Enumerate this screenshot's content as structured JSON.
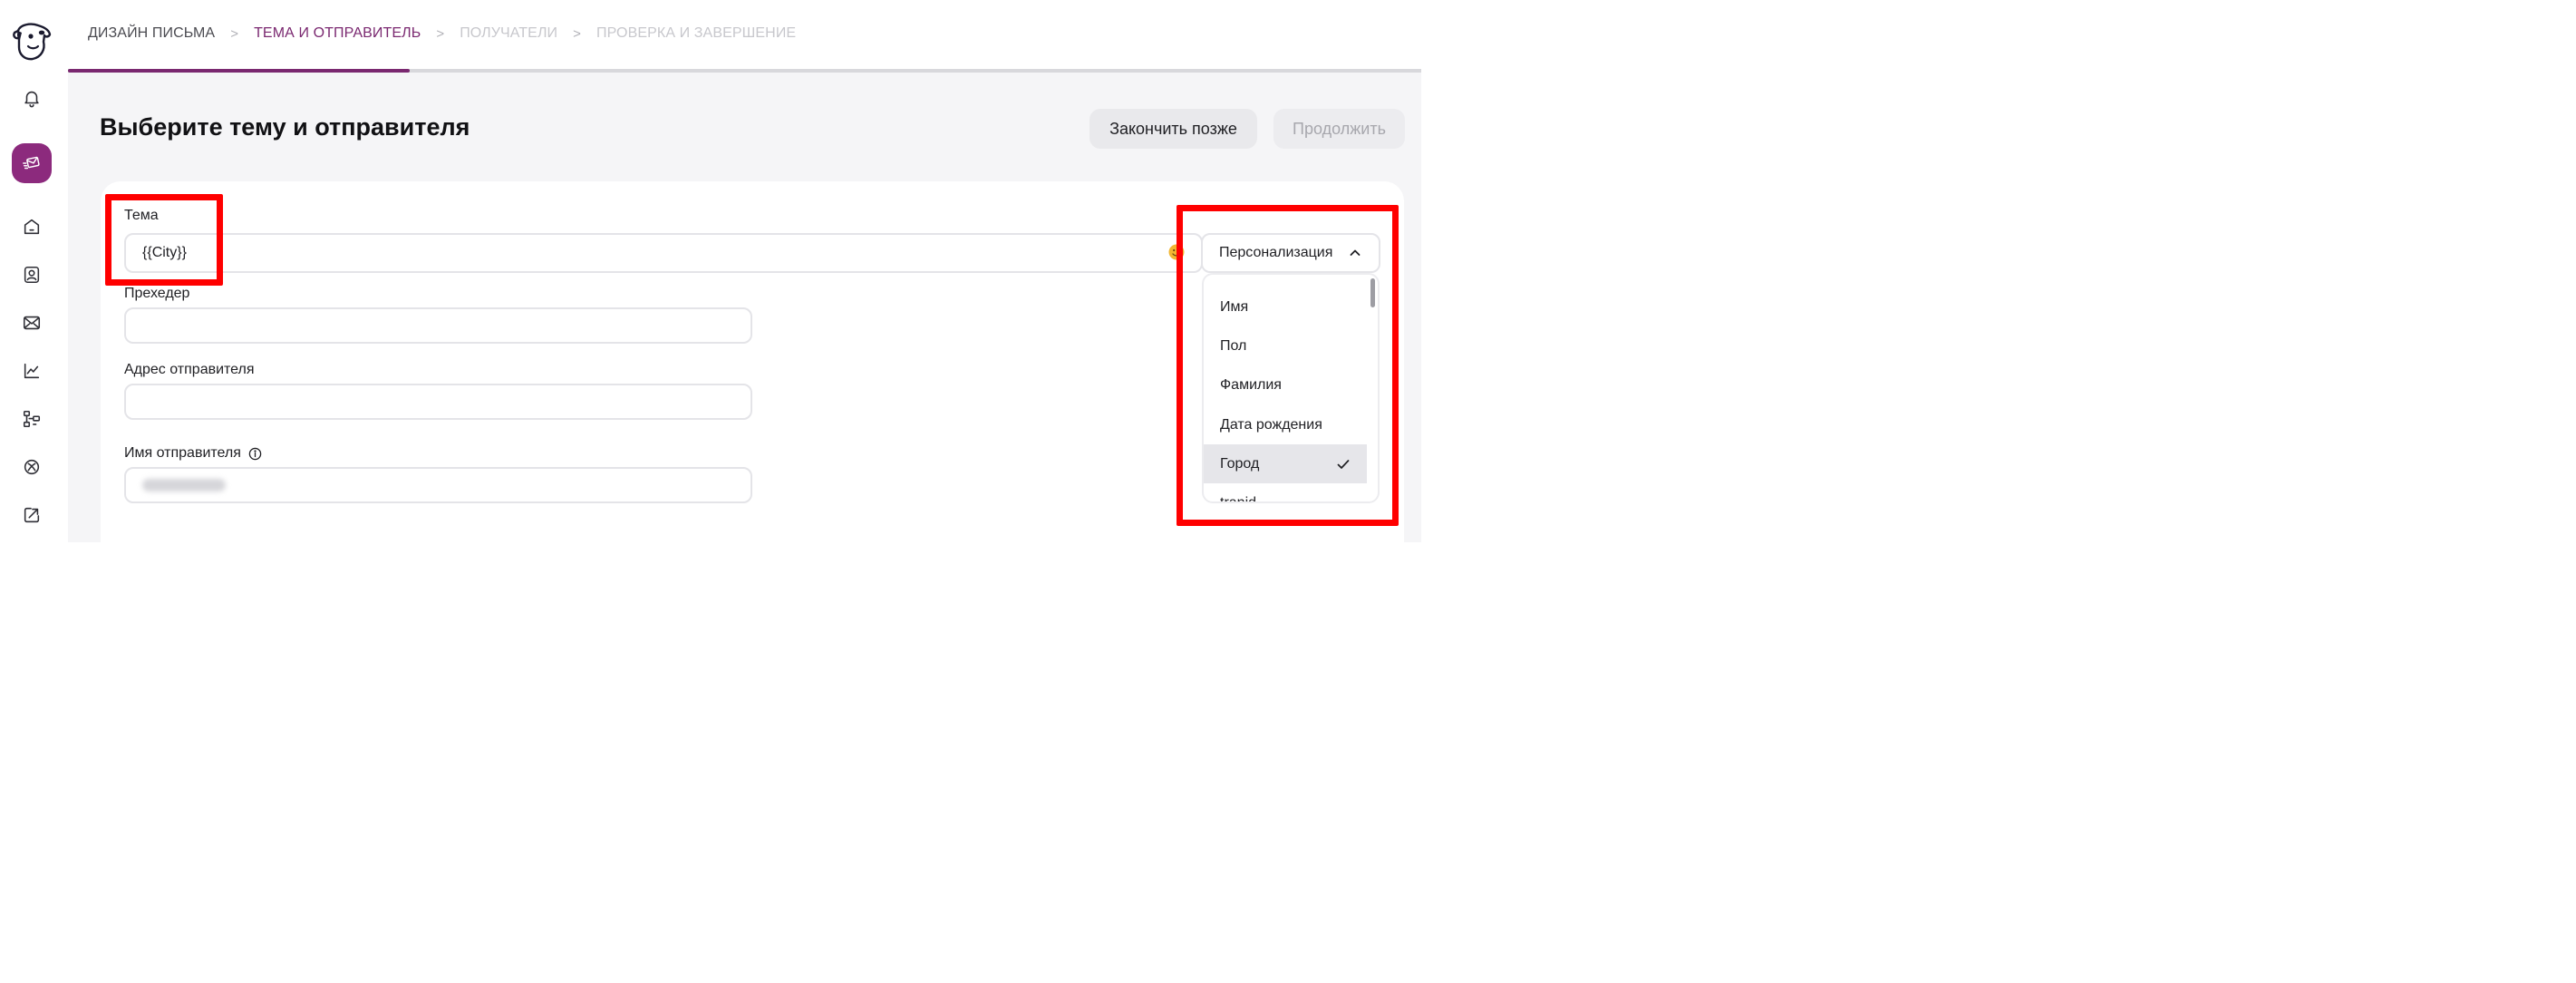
{
  "breadcrumb": {
    "steps": [
      {
        "label": "ДИЗАЙН ПИСЬМА",
        "state": "done"
      },
      {
        "label": "ТЕМА И ОТПРАВИТЕЛЬ",
        "state": "current"
      },
      {
        "label": "ПОЛУЧАТЕЛИ",
        "state": "upcoming"
      },
      {
        "label": "ПРОВЕРКА И ЗАВЕРШЕНИЕ",
        "state": "upcoming"
      }
    ],
    "separator": ">"
  },
  "progress": {
    "fraction": 0.25
  },
  "sidebar": {
    "items": [
      {
        "icon": "bell-icon",
        "active": false
      },
      {
        "icon": "mail-send-icon",
        "active": true
      },
      {
        "icon": "home-icon",
        "active": false
      },
      {
        "icon": "contacts-icon",
        "active": false
      },
      {
        "icon": "envelope-icon",
        "active": false
      },
      {
        "icon": "chart-icon",
        "active": false
      },
      {
        "icon": "automation-icon",
        "active": false
      },
      {
        "icon": "integrations-icon",
        "active": false
      },
      {
        "icon": "export-icon",
        "active": false
      }
    ]
  },
  "page": {
    "title": "Выберите тему и отправителя",
    "finish_later_label": "Закончить позже",
    "continue_label": "Продолжить"
  },
  "form": {
    "subject_label": "Тема",
    "subject_value": "{{City}}",
    "preheader_label": "Прехедер",
    "preheader_value": "",
    "sender_address_label": "Адрес отправителя",
    "sender_address_value": "",
    "sender_name_label": "Имя отправителя",
    "sender_name_value_hidden": true
  },
  "personalization": {
    "button_label": "Персонализация",
    "options": [
      {
        "label": "Имя",
        "selected": false
      },
      {
        "label": "Пол",
        "selected": false
      },
      {
        "label": "Фамилия",
        "selected": false
      },
      {
        "label": "Дата рождения",
        "selected": false
      },
      {
        "label": "Город",
        "selected": true
      },
      {
        "label": "tranid",
        "selected": false
      }
    ]
  },
  "colors": {
    "accent": "#7a2870",
    "sidebar_active": "#8c2a7d",
    "annotation": "#ff0000",
    "background": "#f5f5f7"
  }
}
